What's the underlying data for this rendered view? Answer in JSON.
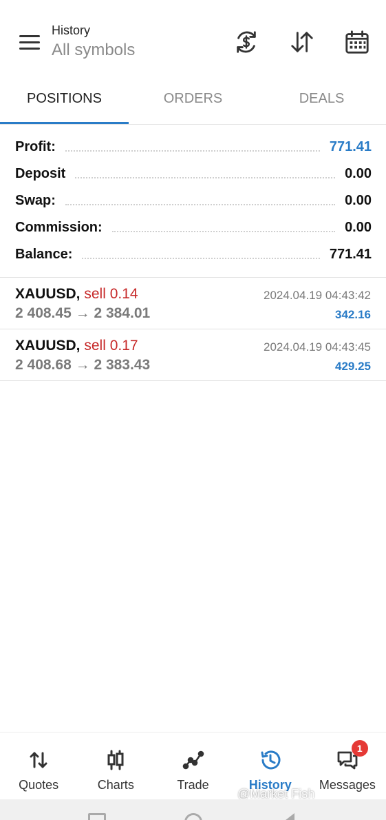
{
  "header": {
    "title": "History",
    "subtitle": "All symbols"
  },
  "header_icons": [
    "currency-exchange-icon",
    "sort-arrows-icon",
    "calendar-icon"
  ],
  "tabs": [
    {
      "label": "POSITIONS",
      "active": true
    },
    {
      "label": "ORDERS",
      "active": false
    },
    {
      "label": "DEALS",
      "active": false
    }
  ],
  "summary": [
    {
      "label": "Profit:",
      "value": "771.41"
    },
    {
      "label": "Deposit",
      "value": "0.00"
    },
    {
      "label": "Swap:",
      "value": "0.00"
    },
    {
      "label": "Commission:",
      "value": "0.00"
    },
    {
      "label": "Balance:",
      "value": "771.41"
    }
  ],
  "positions": [
    {
      "symbol": "XAUUSD,",
      "side": "sell 0.14",
      "open_price": "2 408.45",
      "arrow": "→",
      "close_price": "2 384.01",
      "time": "2024.04.19 04:43:42",
      "profit": "342.16"
    },
    {
      "symbol": "XAUUSD,",
      "side": "sell 0.17",
      "open_price": "2 408.68",
      "arrow": "→",
      "close_price": "2 383.43",
      "time": "2024.04.19 04:43:45",
      "profit": "429.25"
    }
  ],
  "bottom_nav": [
    {
      "label": "Quotes",
      "icon": "quotes-arrows-icon",
      "active": false
    },
    {
      "label": "Charts",
      "icon": "candlestick-icon",
      "active": false
    },
    {
      "label": "Trade",
      "icon": "trade-line-icon",
      "active": false
    },
    {
      "label": "History",
      "icon": "history-clock-icon",
      "active": true
    },
    {
      "label": "Messages",
      "icon": "messages-icon",
      "active": false,
      "badge": "1"
    }
  ],
  "watermark": "@Market Fish",
  "colors": {
    "accent": "#2a7cc7",
    "sell": "#c62828",
    "badge": "#e53935"
  }
}
